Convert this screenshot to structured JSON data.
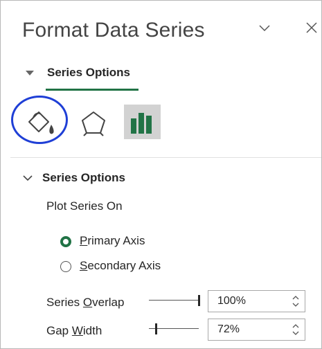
{
  "pane": {
    "title": "Format Data Series",
    "selector_label": "Series Options"
  },
  "tabs": [
    {
      "name": "Fill & Line",
      "icon": "paint-bucket-icon"
    },
    {
      "name": "Effects",
      "icon": "pentagon-icon"
    },
    {
      "name": "Series Options",
      "icon": "bar-chart-icon",
      "selected": true
    }
  ],
  "section": {
    "title": "Series Options",
    "plot_series_on_label": "Plot Series On",
    "primary_axis": {
      "pre": "",
      "accel": "P",
      "post": "rimary Axis",
      "checked": true
    },
    "secondary_axis": {
      "pre": "",
      "accel": "S",
      "post": "econdary Axis",
      "checked": false
    },
    "series_overlap": {
      "pre": "Series ",
      "accel": "O",
      "post": "verlap",
      "value": "100%",
      "slider_fraction": 1.0
    },
    "gap_width": {
      "pre": "Gap ",
      "accel": "W",
      "post": "idth",
      "value": "72%",
      "slider_fraction": 0.144
    }
  },
  "colors": {
    "accent_green": "#217346",
    "highlight_blue": "#1f3fd6"
  }
}
